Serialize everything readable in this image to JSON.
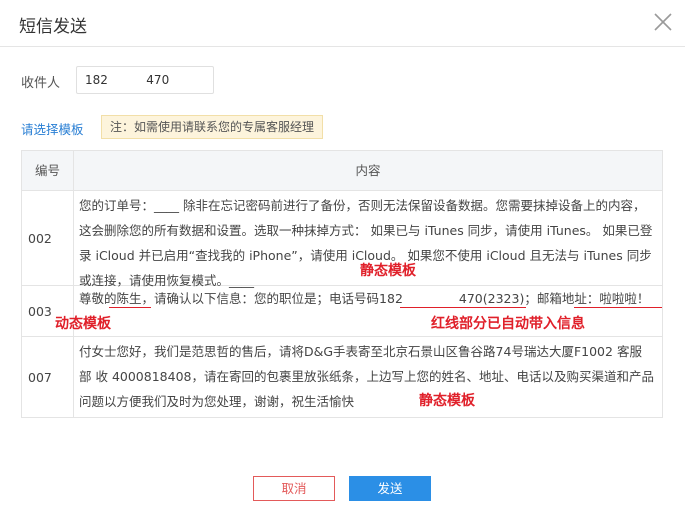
{
  "dialog": {
    "title": "短信发送",
    "close_icon": "close-icon"
  },
  "recipient": {
    "label": "收件人",
    "value": "18          70"
  },
  "template": {
    "choose_label": "请选择模板",
    "notice": "注：如需使用请联系您的专属客服经理"
  },
  "table": {
    "headers": {
      "num": "编号",
      "content": "内容"
    },
    "rows": [
      {
        "num": "002",
        "text": "您的订单号：____ 除非在忘记密码前进行了备份，否则无法保留设备数据。您需要抹掉设备上的内容，这会删除您的所有数据和设置。选取一种抹掉方式： 如果已与 iTunes 同步，请使用 iTunes。 如果已登录 iCloud 并已启用“查找我的 iPhone”，请使用 iCloud。 如果您不使用 iCloud 且无法与 iTunes 同步或连接，请使用恢复模式。____",
        "annotation": "静态模板"
      },
      {
        "num": "003",
        "text_a": "尊敬的",
        "name": "陈生",
        "text_b": "，请确认以下信息：您的职位是；电话号码",
        "phone_a": "182",
        "phone_b": "470(2323)",
        "text_c": "；邮箱地址：",
        "email": "啦啦啦！",
        "annotation_left": "动态模板",
        "annotation_right": "红线部分已自动带入信息"
      },
      {
        "num": "007",
        "text": "付女士您好，我们是范思哲的售后，请将D&G手表寄至北京石景山区鲁谷路74号瑞达大厦F1002 客服部 收 4000818408，请在寄回的包裹里放张纸条，上边写上您的姓名、地址、电话以及购买渠道和产品问题以方便我们及时为您处理，谢谢，祝生活愉快",
        "annotation": "静态模板"
      }
    ]
  },
  "footer": {
    "cancel_label": "取消",
    "send_label": "发送"
  },
  "colors": {
    "accent": "#2b8fe6",
    "link": "#2a7fd4",
    "annotation": "#e0202a",
    "notice_bg": "#fdf4dc"
  }
}
